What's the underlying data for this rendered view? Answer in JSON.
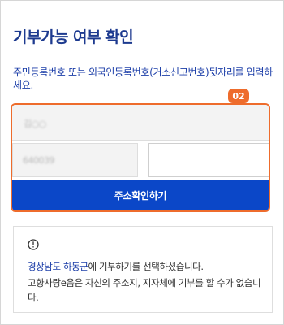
{
  "title": "기부가능 여부 확인",
  "instruction": "주민등록번호 또는 외국인등록번호(거소신고번호)뒷자리를 입력하세요.",
  "step_badge": "02",
  "form": {
    "name_masked": "김○○",
    "birth_masked": "640039",
    "dash": "-",
    "rrn_back_value": "",
    "confirm_button_label": "주소확인하기"
  },
  "notice": {
    "icon": "alert-circle-icon",
    "region": "경상남도 하동군",
    "line1_suffix": "에 기부하기를 선택하셨습니다.",
    "line2": "고향사랑e음은 자신의 주소지, 지자체에 기부를 할 수가 없습니다."
  },
  "colors": {
    "title": "#1d3a8f",
    "instruction": "#1c3ea8",
    "highlight": "#ee6c2c",
    "button": "#0b47c8"
  }
}
